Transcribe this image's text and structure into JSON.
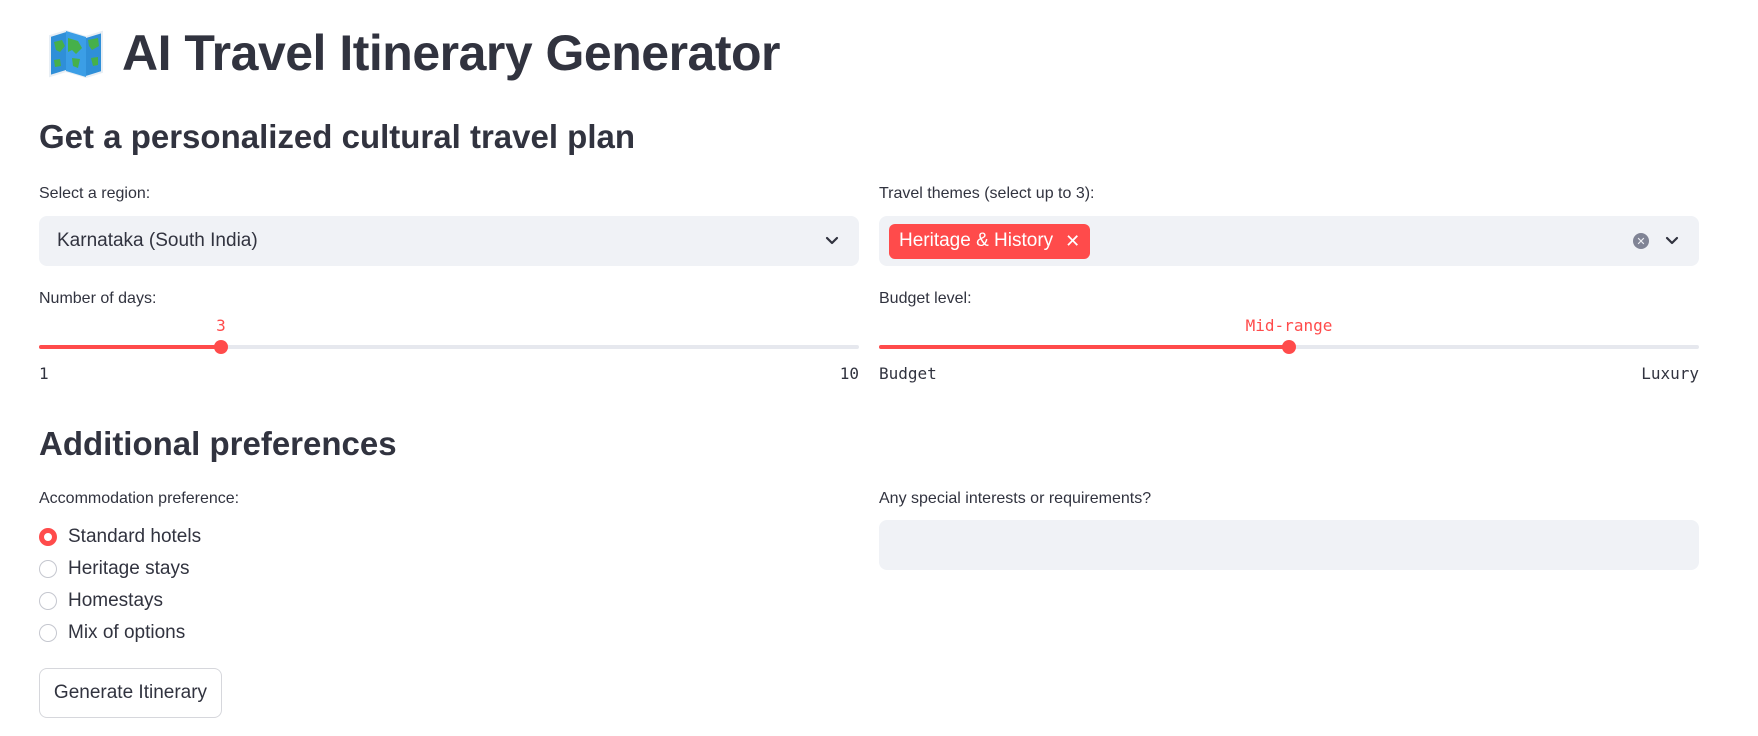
{
  "header": {
    "title": "AI Travel Itinerary Generator",
    "icon": "world-map-icon"
  },
  "subtitle": "Get a personalized cultural travel plan",
  "region": {
    "label": "Select a region:",
    "selected": "Karnataka (South India)"
  },
  "themes": {
    "label": "Travel themes (select up to 3):",
    "selected": [
      "Heritage & History"
    ],
    "remove_glyph": "✕"
  },
  "days": {
    "label": "Number of days:",
    "value": "3",
    "min": "1",
    "max": "10",
    "fraction": 0.2222
  },
  "budget": {
    "label": "Budget level:",
    "value": "Mid-range",
    "min": "Budget",
    "max": "Luxury",
    "fraction": 0.5
  },
  "additional": {
    "title": "Additional preferences"
  },
  "accommodation": {
    "label": "Accommodation preference:",
    "options": [
      "Standard hotels",
      "Heritage stays",
      "Homestays",
      "Mix of options"
    ],
    "selected": "Standard hotels"
  },
  "special": {
    "label": "Any special interests or requirements?",
    "value": "",
    "placeholder": ""
  },
  "generate_button": {
    "label": "Generate Itinerary"
  },
  "colors": {
    "accent": "#ff4b4b",
    "text": "#31333f",
    "input_bg": "#f0f2f6"
  }
}
